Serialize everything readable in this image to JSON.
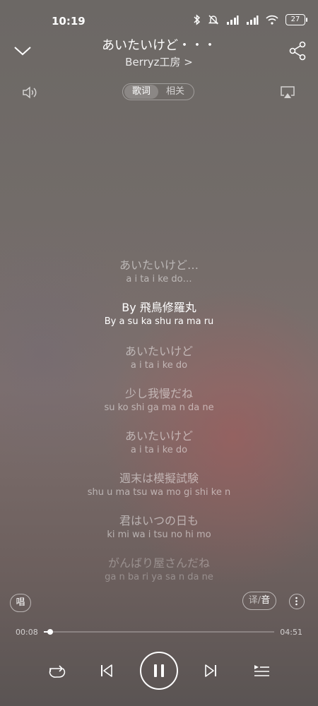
{
  "status": {
    "time": "10:19",
    "battery": "27"
  },
  "header": {
    "title": "あいたいけど・・・",
    "artist": "Berryz工房 >"
  },
  "tabs": [
    {
      "label": "歌词"
    },
    {
      "label": "相关"
    }
  ],
  "lyrics": [
    {
      "jp": "あいたいけど…",
      "rom": "a i ta i ke do…"
    },
    {
      "jp": "By  飛鳥修羅丸",
      "rom": "By  a su ka shu ra ma ru"
    },
    {
      "jp": "あいたいけど",
      "rom": "a i ta i ke do"
    },
    {
      "jp": "少し我慢だね",
      "rom": "su ko shi ga ma n da ne"
    },
    {
      "jp": "あいたいけど",
      "rom": "a i ta i ke do"
    },
    {
      "jp": "週末は模擬試験",
      "rom": "shu u ma tsu wa mo gi shi ke n"
    },
    {
      "jp": "君はいつの日も",
      "rom": "ki mi wa i tsu no hi mo"
    },
    {
      "jp": "がんばり屋さんだね",
      "rom": "ga n ba ri ya sa n da ne"
    }
  ],
  "current_line": 1,
  "tools": {
    "sing_label": "唱",
    "translate_label": "译",
    "phonetic_label": "音"
  },
  "progress": {
    "current": "00:08",
    "total": "04:51",
    "fraction": 0.028
  },
  "icons": {
    "collapse": "chevron-down-icon",
    "share": "share-icon",
    "volume": "speaker-icon",
    "cast": "airplay-icon",
    "repeat": "repeat-icon",
    "prev": "skip-previous-icon",
    "play": "pause-icon",
    "next": "skip-next-icon",
    "playlist": "playlist-icon"
  }
}
